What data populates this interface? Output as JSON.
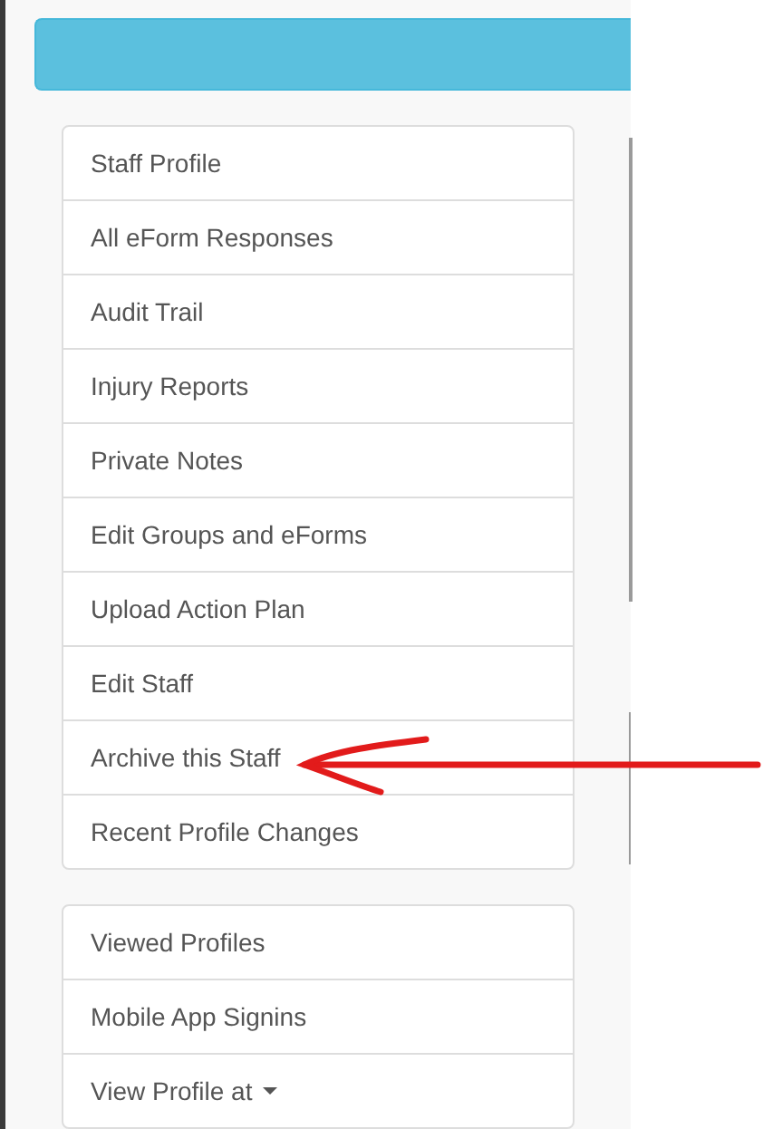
{
  "menu_groups": [
    {
      "items": [
        {
          "label": "Staff Profile",
          "kind": "link"
        },
        {
          "label": "All eForm Responses",
          "kind": "link"
        },
        {
          "label": "Audit Trail",
          "kind": "link"
        },
        {
          "label": "Injury Reports",
          "kind": "link"
        },
        {
          "label": "Private Notes",
          "kind": "link"
        },
        {
          "label": "Edit Groups and eForms",
          "kind": "link"
        },
        {
          "label": "Upload Action Plan",
          "kind": "link"
        },
        {
          "label": "Edit Staff",
          "kind": "link"
        },
        {
          "label": "Archive this Staff",
          "kind": "link"
        },
        {
          "label": "Recent Profile Changes",
          "kind": "link"
        }
      ]
    },
    {
      "items": [
        {
          "label": "Viewed Profiles",
          "kind": "link"
        },
        {
          "label": "Mobile App Signins",
          "kind": "link"
        },
        {
          "label": "View Profile at",
          "kind": "dropdown"
        }
      ]
    }
  ]
}
